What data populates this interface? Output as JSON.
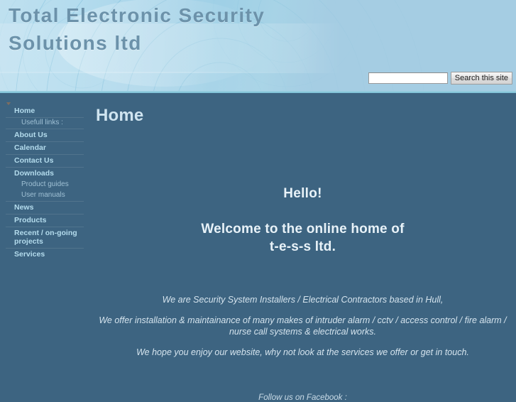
{
  "header": {
    "site_title": "Total Electronic Security Solutions ltd",
    "search": {
      "value": "",
      "placeholder": "",
      "button_label": "Search this site"
    }
  },
  "sidebar": {
    "items": [
      {
        "label": "Home",
        "level": "top",
        "expandable": true
      },
      {
        "label": "Usefull links :",
        "level": "sub"
      },
      {
        "label": "About Us",
        "level": "top",
        "expandable": false
      },
      {
        "label": "Calendar",
        "level": "top",
        "expandable": false
      },
      {
        "label": "Contact Us",
        "level": "top",
        "expandable": false
      },
      {
        "label": "Downloads",
        "level": "top",
        "expandable": true
      },
      {
        "label": "Product guides",
        "level": "sub"
      },
      {
        "label": "User manuals",
        "level": "sub"
      },
      {
        "label": "News",
        "level": "top",
        "expandable": false
      },
      {
        "label": "Products",
        "level": "top",
        "expandable": false
      },
      {
        "label": "Recent / on-going projects",
        "level": "top",
        "expandable": false
      },
      {
        "label": "Services",
        "level": "top",
        "expandable": false
      }
    ]
  },
  "main": {
    "page_title": "Home",
    "hello": "Hello!",
    "welcome_line_1": "Welcome to the online home of",
    "welcome_line_2": "t-e-s-s ltd.",
    "paragraph_1": "We are Security System Installers / Electrical Contractors based in Hull,",
    "paragraph_2": "We offer installation & maintainance of many makes of intruder alarm / cctv / access control / fire alarm / nurse call systems & electrical works.",
    "paragraph_3": "We hope you enjoy our website, why not look at the services we offer or get in touch.",
    "facebook_line": "Follow us on Facebook :"
  },
  "colors": {
    "header_light_blue": "#a5cde3",
    "header_title_text": "#6c92aa",
    "body_background": "#3d6481",
    "separator_cyan": "#7ec2d7",
    "nav_top_text": "#b4dced",
    "nav_sub_text": "#9fc0d4",
    "nav_divider": "#51748d",
    "heading_text": "#e8f2f8"
  }
}
